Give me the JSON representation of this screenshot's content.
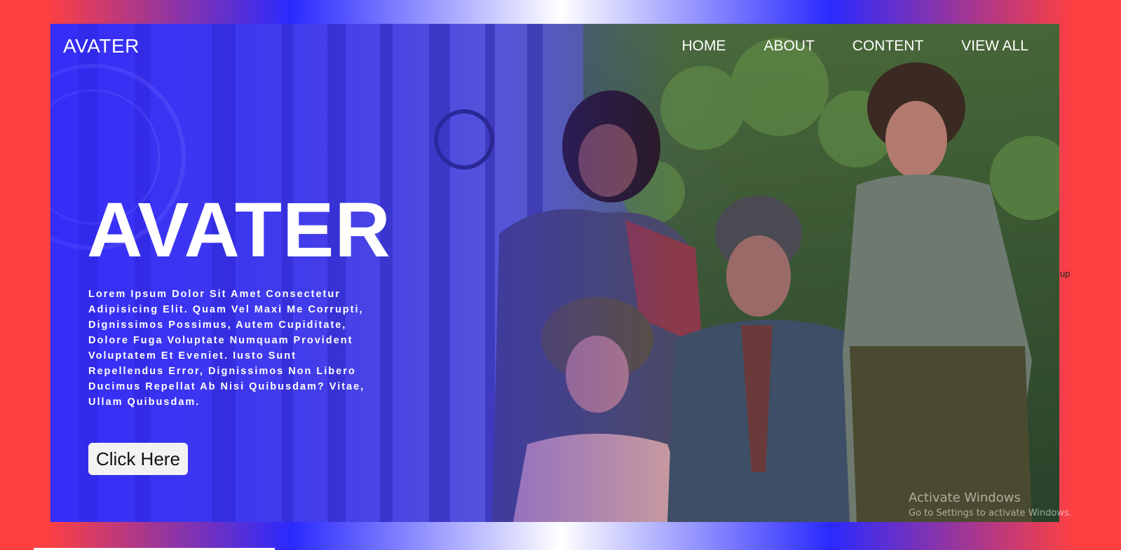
{
  "nav": {
    "logo": "AVATER",
    "links": [
      "HOME",
      "ABOUT",
      "CONTENT",
      "VIEW ALL"
    ]
  },
  "hero": {
    "title": "AVATER",
    "description": "Lorem Ipsum Dolor Sit Amet Consectetur Adipisicing Elit. Quam Vel Maxi Me Corrupti, Dignissimos Possimus, Autem Cupiditate, Dolore Fuga Voluptate Numquam Provident Voluptatem Et Eveniet. Iusto Sunt Repellendus Error, Dignissimos Non Libero Ducimus Repellat Ab Nisi Quibusdam? Vitae, Ullam Quibusdam.",
    "button_label": "Click Here"
  },
  "overlay_text": {
    "stray": "up",
    "activate_title": "Activate Windows",
    "activate_sub": "Go to Settings to activate Windows."
  },
  "colors": {
    "page_gradient": [
      "#ff4040",
      "#2a2aff",
      "#ffffff"
    ],
    "hero_overlay": "#2d23ff",
    "text": "#ffffff",
    "button_bg": "#f2f2f2"
  },
  "icons": {
    "watermark": "magazine-seal-watermark"
  }
}
